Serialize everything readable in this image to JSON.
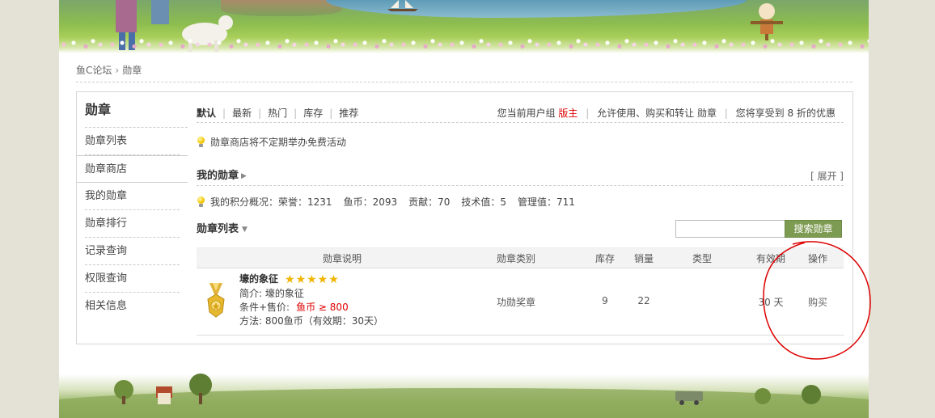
{
  "breadcrumb": {
    "home": "鱼C论坛",
    "separator": "›",
    "current": "勋章"
  },
  "sidebar": {
    "title": "勋章",
    "items": [
      {
        "label": "勋章列表"
      },
      {
        "label": "勋章商店"
      },
      {
        "label": "我的勋章"
      },
      {
        "label": "勋章排行"
      },
      {
        "label": "记录查询"
      },
      {
        "label": "权限查询"
      },
      {
        "label": "相关信息"
      }
    ]
  },
  "tabs": [
    "默认",
    "最新",
    "热门",
    "库存",
    "推荐"
  ],
  "group_info": {
    "prefix": "您当前用户组",
    "group": "版主",
    "permission": "允许使用、购买和转让 勋章",
    "discount_prefix": "您将享受到",
    "discount_value": "8",
    "discount_suffix": "折的优惠"
  },
  "notice": "勋章商店将不定期举办免费活动",
  "my_medals": {
    "title": "我的勋章",
    "expand": "[ 展开 ]"
  },
  "points": {
    "label": "我的积分概况：",
    "items": [
      {
        "text": "荣誉：1231"
      },
      {
        "text": "鱼币：2093"
      },
      {
        "text": "贡献：70"
      },
      {
        "text": "技术值：5"
      },
      {
        "text": "管理值：711"
      }
    ]
  },
  "medal_list": {
    "title": "勋章列表",
    "search_button": "搜索勋章",
    "search_value": ""
  },
  "table": {
    "headers": [
      "勋章说明",
      "勋章类别",
      "库存",
      "销量",
      "类型",
      "有效期",
      "操作"
    ],
    "rows": [
      {
        "name": "壕的象征",
        "stars": 5,
        "stars_text": "★★★★★",
        "intro": "简介: 壕的象征",
        "condition_label": "条件+售价:",
        "condition_price": "鱼币 ≥ 800",
        "method": "方法:   800鱼币（有效期：30天）",
        "category": "功勋奖章",
        "stock": "9",
        "sales": "22",
        "type": "",
        "validity": "30 天",
        "action": "购买"
      }
    ]
  },
  "colors": {
    "accent_red": "#dd0000",
    "search_button": "#7e9b52",
    "annotation_circle": "#dd0000"
  }
}
